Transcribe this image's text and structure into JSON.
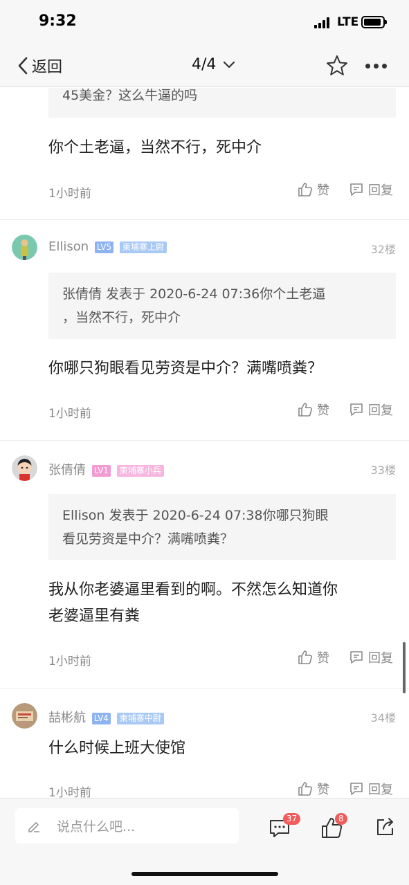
{
  "status": {
    "time": "9:32",
    "network": "LTE"
  },
  "nav": {
    "back_label": "返回",
    "page_indicator": "4/4"
  },
  "partial_comment": {
    "quote": "45美金？这么牛逼的吗",
    "text": "你个土老逼，当然不行，死中介",
    "time": "1小时前",
    "like_label": "赞",
    "reply_label": "回复"
  },
  "comments": [
    {
      "username": "Ellison",
      "level": "LV5",
      "title": "柬埔寨上尉",
      "floor": "32楼",
      "quote_line1": "张倩倩 发表于 2020-6-24 07:36你个土老逼",
      "quote_line2": "，当然不行，死中介",
      "text_line1": "你哪只狗眼看见劳资是中介？满嘴喷粪？",
      "text_line2": "",
      "time": "1小时前",
      "like_label": "赞",
      "reply_label": "回复"
    },
    {
      "username": "张倩倩",
      "level": "LV1",
      "title": "柬埔寨小兵",
      "floor": "33楼",
      "quote_line1": "Ellison 发表于 2020-6-24 07:38你哪只狗眼",
      "quote_line2": "看见劳资是中介？满嘴喷粪？",
      "text_line1": "我从你老婆逼里看到的啊。不然怎么知道你",
      "text_line2": "老婆逼里有粪",
      "time": "1小时前",
      "like_label": "赞",
      "reply_label": "回复"
    },
    {
      "username": "喆彬航",
      "level": "LV4",
      "title": "柬埔寨中尉",
      "floor": "34楼",
      "text_line1": "什么时候上班大使馆",
      "time": "1小时前",
      "like_label": "赞",
      "reply_label": "回复"
    }
  ],
  "bottom": {
    "input_placeholder": "说点什么吧...",
    "comment_count": "37",
    "like_count": "8"
  },
  "colors": {
    "lv5_badge": "#8db4f0",
    "lv4_badge": "#8db4f0",
    "lv1_badge": "#f49ad2",
    "title_blue": "#a9c9f5",
    "title_pink": "#f6b6e0",
    "count_badge": "#f15b5b"
  }
}
